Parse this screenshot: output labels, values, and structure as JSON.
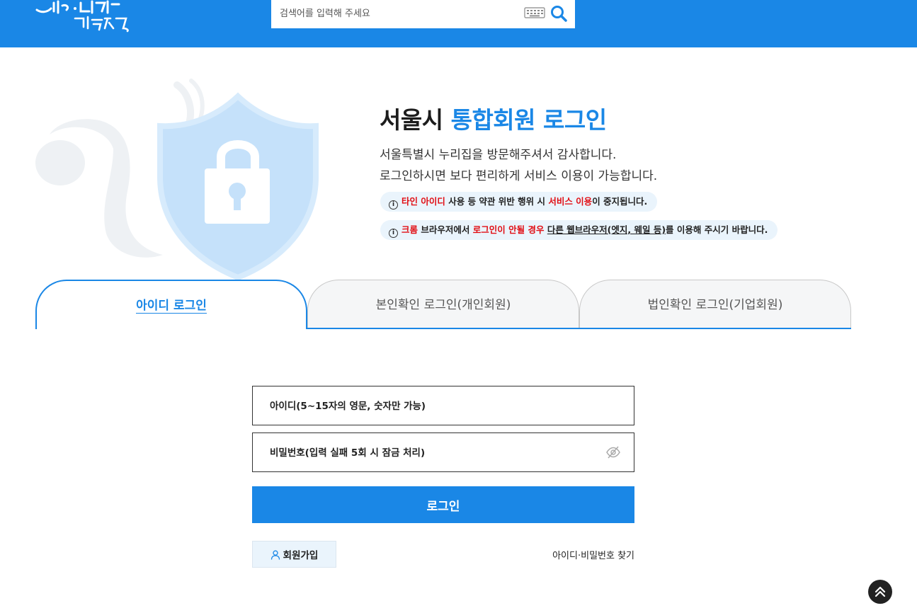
{
  "header": {
    "logo_alt": "동행·매력 특별시 서울",
    "search_placeholder": "검색어를 입력해 주세요",
    "keyboard_icon": "keyboard-icon",
    "search_icon": "search-icon",
    "brand_color": "#1a87e6"
  },
  "hero": {
    "title_main": "서울시 ",
    "title_accent": "통합회원 로그인",
    "desc_line1": "서울특별시 누리집을 방문해주셔서 감사합니다.",
    "desc_line2": "로그인하시면 보다 편리하게 서비스 이용이 가능합니다.",
    "notice1": {
      "icon": "i",
      "red1": "타인 아이디",
      "text1": " 사용 등 약관 위반 행위 시 ",
      "red2": "서비스 이용",
      "text2": "이 중지됩니다."
    },
    "notice2": {
      "icon": "i",
      "red1": "크롬",
      "text1": " 브라우저에서 ",
      "red2": "로그인이 안될 경우",
      "text2": " ",
      "underline": "다른 웹브라우저(엣지, 웨일 등)",
      "text3": "를 이용해 주시기 바랍니다."
    }
  },
  "tabs": [
    {
      "label": "아이디 로그인",
      "active": true
    },
    {
      "label": "본인확인 로그인(개인회원)",
      "active": false
    },
    {
      "label": "법인확인 로그인(기업회원)",
      "active": false
    }
  ],
  "form": {
    "id_placeholder": "아이디(5~15자의 영문, 숫자만 가능)",
    "pw_placeholder": "비밀번호(입력 실패 5회 시 잠금 처리)",
    "login_label": "로그인",
    "join_label": "회원가입",
    "find_label": "아이디·비밀번호 찾기"
  }
}
